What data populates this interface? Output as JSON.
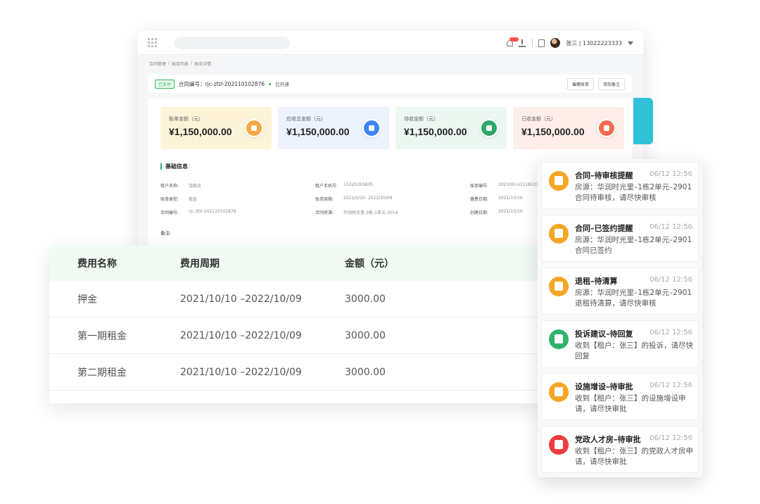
{
  "app": {
    "user": "张三 | 13022223333",
    "breadcrumb": [
      "合同管理",
      "/",
      "账单列表",
      "/",
      "账单详情"
    ],
    "bill": {
      "status_tag": "已支付",
      "contract_no": "合同编号：rjc-zfzl-202110102876",
      "status_text": "已开通",
      "buttons": [
        "催缴账单",
        "添加备注"
      ]
    },
    "stats": [
      {
        "label": "账单金额（元）",
        "value": "¥1,150,000.00",
        "bg": "#fdf3d9",
        "icon": "receipt-icon",
        "icon_color": "#f5a742"
      },
      {
        "label": "应收总金额（元）",
        "value": "¥1,150,000.00",
        "bg": "#edf3fd",
        "icon": "home-icon",
        "icon_color": "#3f86f5"
      },
      {
        "label": "待收金额（元）",
        "value": "¥1,150,000.00",
        "bg": "#ecf7f1",
        "icon": "money-icon",
        "icon_color": "#2ea86a"
      },
      {
        "label": "已收金额（元）",
        "value": "¥1,150,000.00",
        "bg": "#fdeee9",
        "icon": "check-icon",
        "icon_color": "#f56a52"
      }
    ],
    "section_title": "基础信息",
    "info_rows": [
      [
        {
          "label": "租户名称:",
          "value": "饶政忠"
        },
        {
          "label": "租户手机号:",
          "value": "15325355835"
        },
        {
          "label": "账单编号:",
          "value": "2021091415165338"
        }
      ],
      [
        {
          "label": "账单类型:",
          "value": "租金"
        },
        {
          "label": "账单周期:",
          "value": "2021/0/10- 2022/10/09"
        },
        {
          "label": "缴费日期:",
          "value": "2021/10/10"
        }
      ],
      [
        {
          "label": "合同编号:",
          "value": "rjc-zfzl-202110102876"
        },
        {
          "label": "合同房源:",
          "value": "华润时光里-3栋-1单元-301A"
        },
        {
          "label": "创建日期:",
          "value": "2021/10/10"
        }
      ]
    ],
    "remark_label": "备注:"
  },
  "fee_table": {
    "headers": [
      "费用名称",
      "费用周期",
      "金额（元）"
    ],
    "rows": [
      [
        "押金",
        "2021/10/10 –2022/10/09",
        "3000.00"
      ],
      [
        "第一期租金",
        "2021/10/10 –2022/10/09",
        "3000.00"
      ],
      [
        "第二期租金",
        "2021/10/10 –2022/10/09",
        "3000.00"
      ]
    ]
  },
  "notifications": [
    {
      "title": "合同–待审核提醒",
      "time": "06/12 12:56",
      "body": "房源：华润时光里–1栋2单元–2901 合同待审核，请尽快审核",
      "icon": "contract-icon",
      "color": "#f5a623"
    },
    {
      "title": "合同–已签约提醒",
      "time": "06/12 12:56",
      "body": "房源：华润时光里–1栋2单元–2901 合同已签约",
      "icon": "contract-icon",
      "color": "#f5a623"
    },
    {
      "title": "退租–待清算",
      "time": "06/12 12:56",
      "body": "房源：华润时光里–1栋2单元–2901 退租待清算，请尽快审核",
      "icon": "house-return-icon",
      "color": "#f5a623"
    },
    {
      "title": "投诉建议–待回复",
      "time": "06/12 12:56",
      "body": "收到【租户：张三】的投诉，请尽快回复",
      "icon": "complaint-icon",
      "color": "#2fb36b"
    },
    {
      "title": "设施增设–待审批",
      "time": "06/12 12:56",
      "body": "收到【租户：张三】的设施增设申请，请尽快审批",
      "icon": "facility-icon",
      "color": "#f5a623"
    },
    {
      "title": "党政人才房–待审批",
      "time": "06/12 12:56",
      "body": "收到【租户：张三】的党政人才房申请，请尽快审批",
      "icon": "talent-house-icon",
      "color": "#ee3b3b"
    }
  ]
}
